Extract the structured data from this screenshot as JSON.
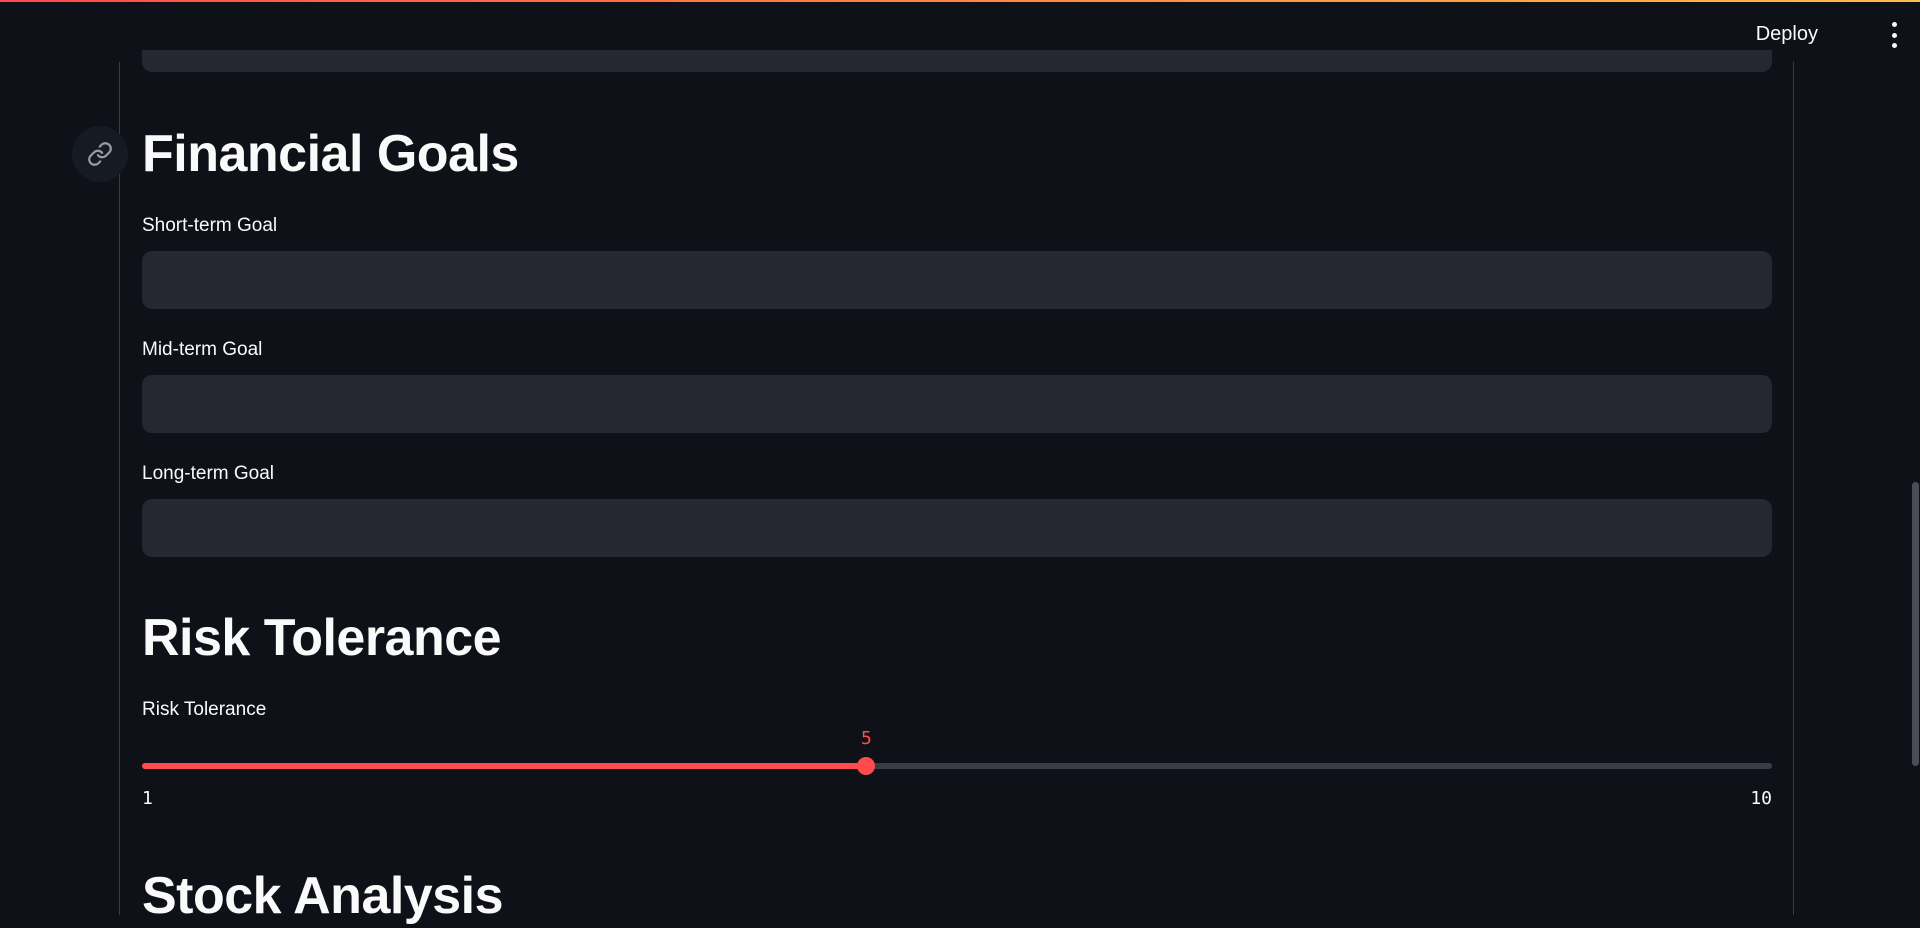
{
  "header": {
    "deploy_label": "Deploy",
    "menu_icon": "kebab-menu-icon"
  },
  "icons": {
    "anchor": "link-icon"
  },
  "colors": {
    "background": "#0e1117",
    "input_background": "#262730",
    "accent": "#ff4b4b",
    "text": "#fafafa"
  },
  "financial_goals": {
    "title": "Financial Goals",
    "short_term": {
      "label": "Short-term Goal",
      "value": ""
    },
    "mid_term": {
      "label": "Mid-term Goal",
      "value": ""
    },
    "long_term": {
      "label": "Long-term Goal",
      "value": ""
    }
  },
  "risk_tolerance": {
    "title": "Risk Tolerance",
    "slider": {
      "label": "Risk Tolerance",
      "value": 5,
      "min": 1,
      "max": 10
    }
  },
  "stock_analysis": {
    "title": "Stock Analysis"
  }
}
